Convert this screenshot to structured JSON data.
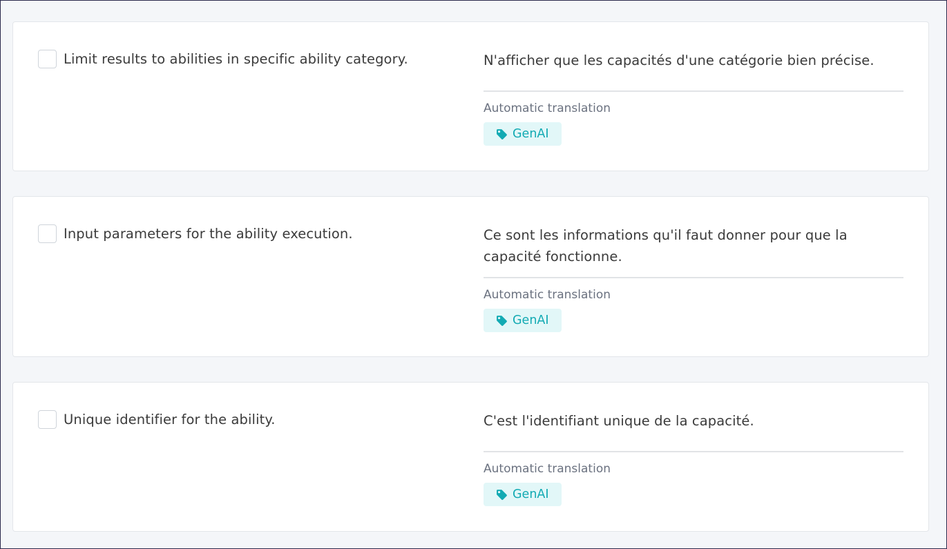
{
  "rows": [
    {
      "source": "Limit results to abilities in specific ability category.",
      "translation": "N'afficher que les capacités d'une catégorie bien précise.",
      "meta_label": "Automatic translation",
      "tag": "GenAI"
    },
    {
      "source": "Input parameters for the ability execution.",
      "translation": "Ce sont les informations qu'il faut donner pour que la capacité fonctionne.",
      "meta_label": "Automatic translation",
      "tag": "GenAI"
    },
    {
      "source": "Unique identifier for the ability.",
      "translation": "C'est l'identifiant unique de la capacité.",
      "meta_label": "Automatic translation",
      "tag": "GenAI"
    }
  ],
  "icons": {
    "tag_icon": "tag-icon"
  },
  "colors": {
    "tag_text": "#12aab3",
    "tag_bg": "#e2f7f8",
    "page_bg": "#f4f6f9"
  }
}
